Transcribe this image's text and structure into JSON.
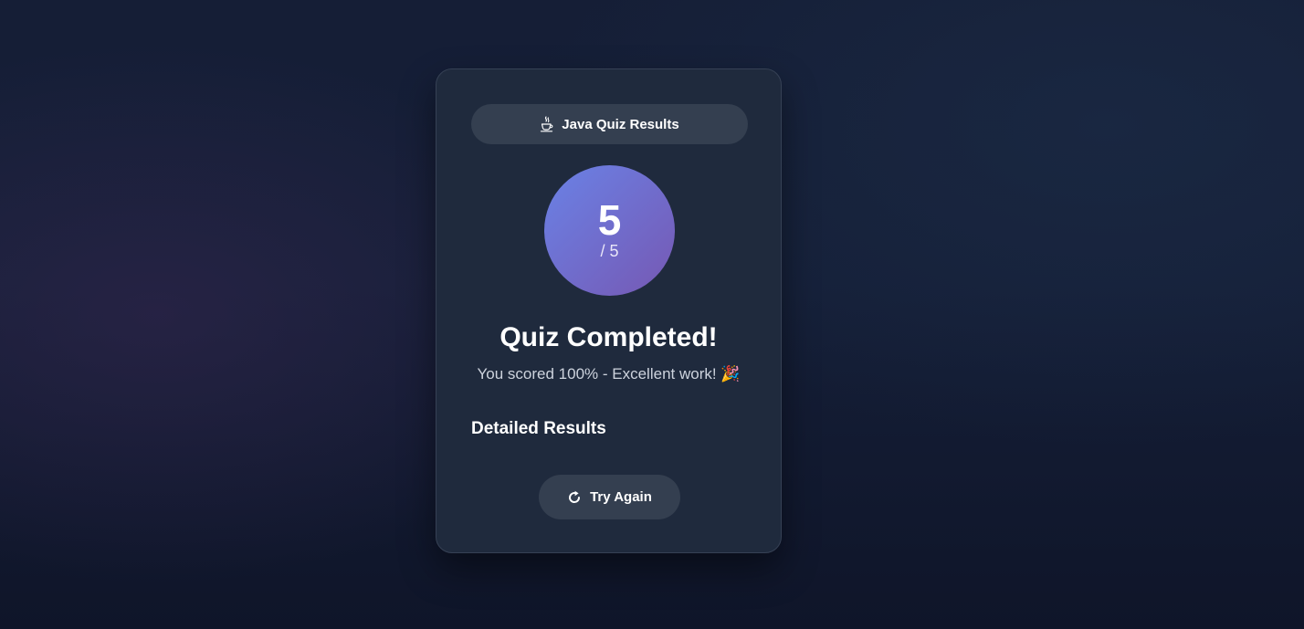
{
  "badge": {
    "icon": "coffee-cup-icon",
    "label": "Java Quiz Results"
  },
  "score": {
    "value": "5",
    "total": "/ 5"
  },
  "result": {
    "title": "Quiz Completed!",
    "message": "You scored 100% - Excellent work! 🎉"
  },
  "details": {
    "heading": "Detailed Results"
  },
  "actions": {
    "try_again_icon": "rotate-cw-icon",
    "try_again_label": "Try Again"
  },
  "colors": {
    "accent_gradient_start": "#6a82e6",
    "accent_gradient_end": "#7658b3",
    "card_background": "#1f2a3d",
    "button_background": "#343f50"
  }
}
